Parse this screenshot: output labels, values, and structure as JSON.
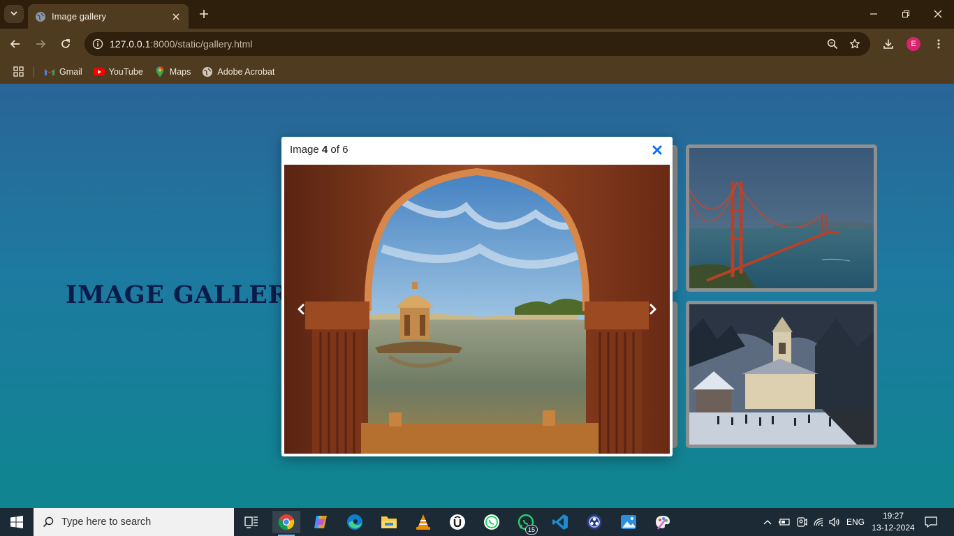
{
  "browser": {
    "tab": {
      "title": "Image gallery"
    },
    "address_bar": {
      "host": "127.0.0.1",
      "path": ":8000/static/gallery.html"
    },
    "profile_initial": "E",
    "bookmarks": [
      {
        "label": "Gmail",
        "icon": "gmail-icon"
      },
      {
        "label": "YouTube",
        "icon": "youtube-icon"
      },
      {
        "label": "Maps",
        "icon": "maps-icon"
      },
      {
        "label": "Adobe Acrobat",
        "icon": "globe-icon"
      }
    ]
  },
  "page": {
    "heading": "IMAGE GALLERY",
    "lightbox": {
      "caption_prefix": "Image",
      "current": "4",
      "caption_middle": "of",
      "total": "6",
      "image": "desert-lake-palace-arch",
      "close_icon": "close-icon",
      "prev_icon": "chevron-left-icon",
      "next_icon": "chevron-right-icon"
    },
    "thumbnails": [
      {
        "image": "golden-gate-bridge"
      },
      {
        "image": "snowy-church-hill-town"
      }
    ]
  },
  "taskbar": {
    "search_placeholder": "Type here to search",
    "apps": [
      {
        "name": "task-view"
      },
      {
        "name": "chrome",
        "active": true
      },
      {
        "name": "copilot"
      },
      {
        "name": "edge"
      },
      {
        "name": "file-explorer"
      },
      {
        "name": "vlc"
      },
      {
        "name": "udemy"
      },
      {
        "name": "whatsapp"
      },
      {
        "name": "whatsapp-business",
        "badge": "15"
      },
      {
        "name": "vscode"
      },
      {
        "name": "obs"
      },
      {
        "name": "photos"
      },
      {
        "name": "paint"
      }
    ],
    "language": "ENG",
    "time": "19:27",
    "date": "13-12-2024"
  },
  "colors": {
    "accent": "#0d6efd",
    "heading": "#0c1c4a",
    "page_gradient_top": "#2a6597",
    "page_gradient_bottom": "#0f8590"
  }
}
